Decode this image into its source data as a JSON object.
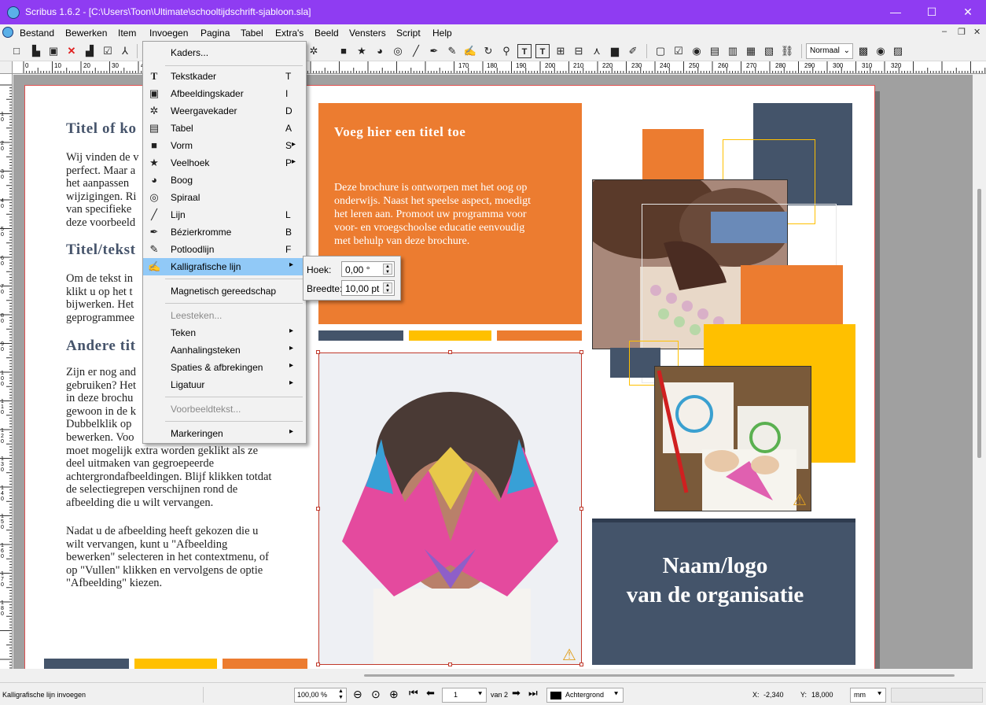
{
  "window": {
    "title": "Scribus 1.6.2 - [C:\\Users\\Toon\\Ultimate\\schooltijdschrift-sjabloon.sla]",
    "minimize": "—",
    "maximize": "☐",
    "close": "✕"
  },
  "menubar": {
    "items": [
      "Bestand",
      "Bewerken",
      "Item",
      "Invoegen",
      "Pagina",
      "Tabel",
      "Extra's",
      "Beeld",
      "Vensters",
      "Script",
      "Help"
    ],
    "doc_min": "‒",
    "doc_restore": "❐",
    "doc_close": "✕"
  },
  "toolbar": {
    "view_mode": "Normaal"
  },
  "ruler": {
    "h_labels": [
      "0",
      "10",
      "20",
      "30",
      "40",
      "170",
      "180",
      "190",
      "200",
      "210",
      "220",
      "230",
      "240",
      "250",
      "260",
      "270",
      "280",
      "290",
      "300",
      "310",
      "320"
    ],
    "v_labels": [
      "10",
      "20",
      "30",
      "40",
      "50",
      "60",
      "70",
      "80",
      "90",
      "100",
      "110",
      "120",
      "130",
      "140",
      "150",
      "160",
      "170",
      "180"
    ]
  },
  "document": {
    "left_col": {
      "heading1": "Titel of ko",
      "para1": [
        "Wij vinden de v",
        "perfect. Maar a",
        "het aanpassen",
        "wijzigingen. Ri",
        "van specifieke",
        "deze voorbeeld"
      ],
      "heading2": "Titel/tekst",
      "para2": [
        "Om de tekst in",
        "klikt u op het t",
        "bijwerken. Het",
        "geprogrammee"
      ],
      "heading3": "Andere tit",
      "para3": [
        "Zijn er nog and",
        "gebruiken? Het",
        "in deze brochu",
        "gewoon in de k",
        "Dubbelklik op",
        "bewerken. Voo"
      ],
      "para4": [
        "moet mogelijk extra worden geklikt als ze",
        "deel uitmaken van gegroepeerde",
        "achtergrondafbeeldingen. Blijf klikken totdat",
        "de selectiegrepen verschijnen rond de",
        "afbeelding die u wilt vervangen."
      ],
      "para5": [
        "Nadat u de afbeelding heeft gekozen die u",
        "wilt vervangen, kunt u \"Afbeelding",
        "bewerken\" selecteren in het contextmenu, of",
        "op \"Vullen\" klikken en vervolgens de optie",
        "\"Afbeelding\" kiezen."
      ]
    },
    "orange_box": {
      "title": "Voeg hier een titel toe",
      "body": [
        "Deze brochure is ontworpen met het oog op",
        "onderwijs. Naast het speelse aspect, moedigt",
        "het leren aan. Promoot uw programma voor",
        "voor- en vroegschoolse educatie eenvoudig",
        "met behulp van deze brochure."
      ]
    },
    "org_box": {
      "line1": "Naam/logo",
      "line2": "van de organisatie"
    },
    "colors": {
      "orange": "#ec7c30",
      "navy": "#44546a",
      "gold": "#ffc000",
      "heading": "#46546b"
    }
  },
  "insert_menu": {
    "frames": "Kaders...",
    "items": [
      {
        "label": "Tekstkader",
        "shortcut": "T",
        "icon": "text-frame-icon"
      },
      {
        "label": "Afbeeldingskader",
        "shortcut": "I",
        "icon": "image-frame-icon"
      },
      {
        "label": "Weergavekader",
        "shortcut": "D",
        "icon": "render-frame-icon"
      },
      {
        "label": "Tabel",
        "shortcut": "A",
        "icon": "table-icon"
      },
      {
        "label": "Vorm",
        "shortcut": "S",
        "icon": "shape-icon"
      },
      {
        "label": "Veelhoek",
        "shortcut": "P",
        "icon": "polygon-icon"
      },
      {
        "label": "Boog",
        "shortcut": "",
        "icon": "arc-icon"
      },
      {
        "label": "Spiraal",
        "shortcut": "",
        "icon": "spiral-icon"
      },
      {
        "label": "Lijn",
        "shortcut": "L",
        "icon": "line-icon"
      },
      {
        "label": "Bézierkromme",
        "shortcut": "B",
        "icon": "bezier-icon"
      },
      {
        "label": "Potloodlijn",
        "shortcut": "F",
        "icon": "pencil-icon"
      },
      {
        "label": "Kalligrafische lijn",
        "shortcut": "",
        "icon": "calligraphy-icon"
      }
    ],
    "magnetic": "Magnetisch gereedschap",
    "glyphs": "Leesteken...",
    "character": "Teken",
    "quote": "Aanhalingsteken",
    "spaces": "Spaties & afbrekingen",
    "ligature": "Ligatuur",
    "sample": "Voorbeeldtekst...",
    "marks": "Markeringen"
  },
  "calligraphy_sub": {
    "angle_label": "Hoek:",
    "angle_value": "0,00 °",
    "width_label": "Breedte:",
    "width_value": "10,00 pt"
  },
  "statusbar": {
    "message": "Kalligrafische lijn invoegen",
    "zoom": "100,00 %",
    "page": "1",
    "of_pages": "van 2",
    "layer": "Achtergrond",
    "x_label": "X:",
    "x_value": "-2,340",
    "y_label": "Y:",
    "y_value": "18,000",
    "unit": "mm"
  }
}
